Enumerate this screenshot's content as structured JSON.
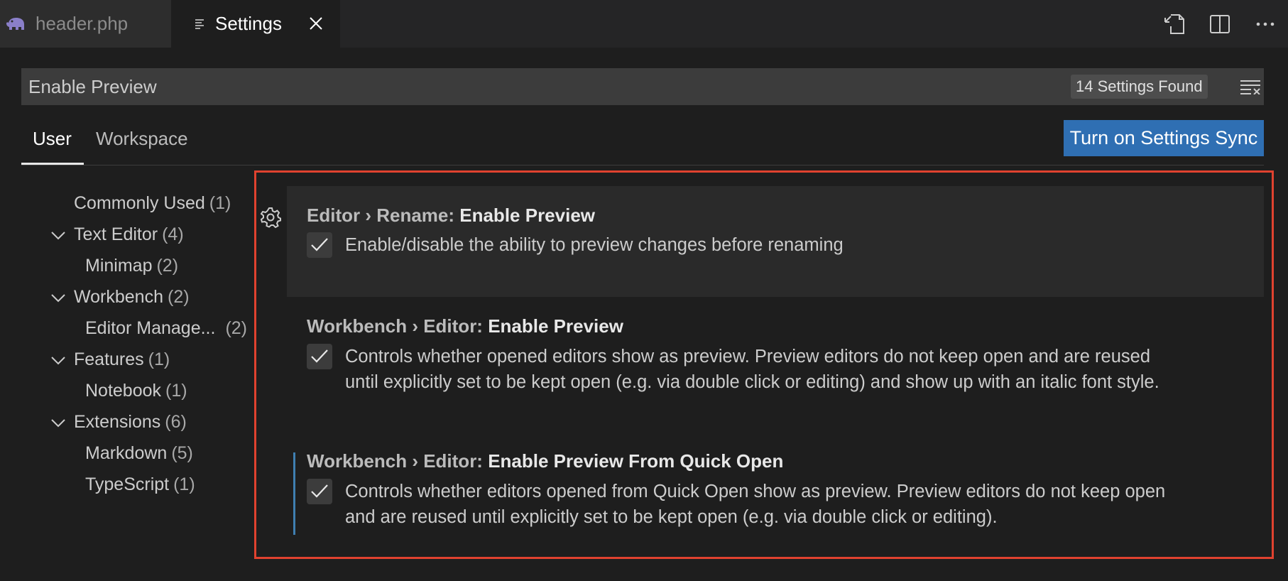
{
  "tabs": [
    {
      "label": "header.php",
      "icon": "php-elephant-icon",
      "active": false
    },
    {
      "label": "Settings",
      "icon": "settings-list-icon",
      "active": true
    }
  ],
  "top_actions": [
    "open-settings-json-icon",
    "split-editor-icon",
    "more-actions-icon"
  ],
  "search": {
    "value": "Enable Preview",
    "results_count": "14 Settings Found",
    "clear_icon": "clear-filter-icon"
  },
  "scope_tabs": [
    {
      "label": "User",
      "active": true
    },
    {
      "label": "Workspace",
      "active": false
    }
  ],
  "sync_button": "Turn on Settings Sync",
  "toc": [
    {
      "label": "Commonly Used",
      "count": "(1)",
      "expanded": null
    },
    {
      "label": "Text Editor",
      "count": "(4)",
      "expanded": true
    },
    {
      "label": "Minimap",
      "count": "(2)",
      "expanded": null
    },
    {
      "label": "Workbench",
      "count": "(2)",
      "expanded": true
    },
    {
      "label": "Editor Manage...",
      "count": "(2)",
      "expanded": null
    },
    {
      "label": "Features",
      "count": "(1)",
      "expanded": true
    },
    {
      "label": "Notebook",
      "count": "(1)",
      "expanded": null
    },
    {
      "label": "Extensions",
      "count": "(6)",
      "expanded": true
    },
    {
      "label": "Markdown",
      "count": "(5)",
      "expanded": null
    },
    {
      "label": "TypeScript",
      "count": "(1)",
      "expanded": null
    }
  ],
  "settings": [
    {
      "category": "Editor › Rename: ",
      "name": "Enable Preview",
      "checked": true,
      "description": "Enable/disable the ability to preview changes before renaming"
    },
    {
      "category": "Workbench › Editor: ",
      "name": "Enable Preview",
      "checked": true,
      "description_lines": [
        "Controls whether opened editors show as preview. Preview editors do not keep open and are reused",
        "until explicitly set to be kept open (e.g. via double click or editing) and show up with an italic font style."
      ]
    },
    {
      "category": "Workbench › Editor: ",
      "name": "Enable Preview From Quick Open",
      "checked": true,
      "modified": true,
      "description_lines": [
        "Controls whether editors opened from Quick Open show as preview. Preview editors do not keep open",
        "and are reused until explicitly set to be kept open (e.g. via double click or editing)."
      ]
    }
  ],
  "colors": {
    "background": "#1e1e1e",
    "tabbar": "#252526",
    "accent_button": "#2f6fb3",
    "highlight_border": "#e0422f",
    "modified_indicator": "#3f7fb1"
  }
}
